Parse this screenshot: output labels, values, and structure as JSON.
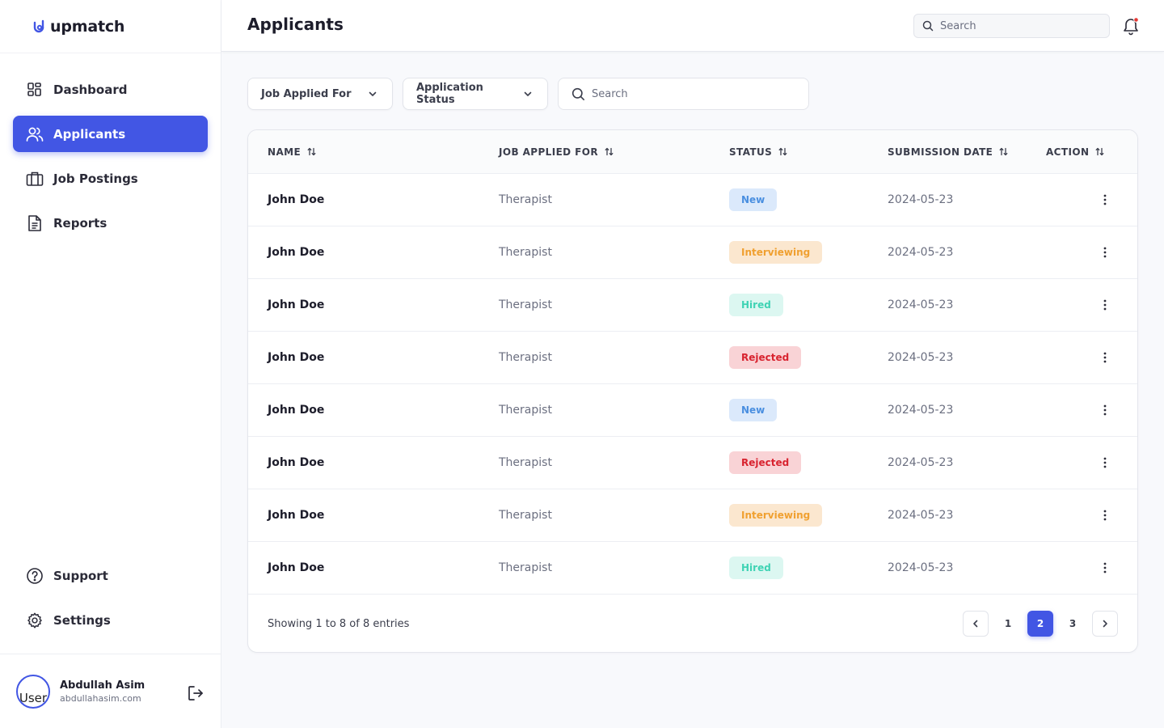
{
  "brand": {
    "name": "upmatch",
    "color": "#4256e4"
  },
  "sidebar": {
    "items": [
      {
        "label": "Dashboard",
        "icon": "dashboard-icon"
      },
      {
        "label": "Applicants",
        "icon": "users-icon",
        "active": true
      },
      {
        "label": "Job Postings",
        "icon": "briefcase-icon"
      },
      {
        "label": "Reports",
        "icon": "document-icon"
      }
    ],
    "bottom_items": [
      {
        "label": "Support",
        "icon": "help-circle-icon"
      },
      {
        "label": "Settings",
        "icon": "gear-icon"
      }
    ],
    "user": {
      "name": "Abdullah Asim",
      "email": "abdullahasim.com",
      "avatar_alt": "User"
    }
  },
  "header": {
    "title": "Applicants",
    "search_placeholder": "Search",
    "notification_dot_color": "#e53935"
  },
  "filters": {
    "job_applied_for": "Job Applied For",
    "application_status": "Application Status",
    "search_placeholder": "Search"
  },
  "table": {
    "columns": [
      "NAME",
      "JOB APPLIED FOR",
      "STATUS",
      "SUBMISSION DATE",
      "ACTION"
    ],
    "rows": [
      {
        "name": "John Doe",
        "job": "Therapist",
        "status": "New",
        "date": "2024-05-23"
      },
      {
        "name": "John Doe",
        "job": "Therapist",
        "status": "Interviewing",
        "date": "2024-05-23"
      },
      {
        "name": "John Doe",
        "job": "Therapist",
        "status": "Hired",
        "date": "2024-05-23"
      },
      {
        "name": "John Doe",
        "job": "Therapist",
        "status": "Rejected",
        "date": "2024-05-23"
      },
      {
        "name": "John Doe",
        "job": "Therapist",
        "status": "New",
        "date": "2024-05-23"
      },
      {
        "name": "John Doe",
        "job": "Therapist",
        "status": "Rejected",
        "date": "2024-05-23"
      },
      {
        "name": "John Doe",
        "job": "Therapist",
        "status": "Interviewing",
        "date": "2024-05-23"
      },
      {
        "name": "John Doe",
        "job": "Therapist",
        "status": "Hired",
        "date": "2024-05-23"
      }
    ],
    "status_colors": {
      "New": {
        "bg": "#dbe9fb",
        "fg": "#4a8fe0"
      },
      "Interviewing": {
        "bg": "#fbe7cf",
        "fg": "#f0a030"
      },
      "Hired": {
        "bg": "#dcf7f1",
        "fg": "#3fd3b4"
      },
      "Rejected": {
        "bg": "#f9d3d6",
        "fg": "#d8232f"
      }
    }
  },
  "footer": {
    "showing": "Showing 1 to 8 of 8 entries",
    "pages": [
      "1",
      "2",
      "3"
    ],
    "current_page": "2"
  }
}
